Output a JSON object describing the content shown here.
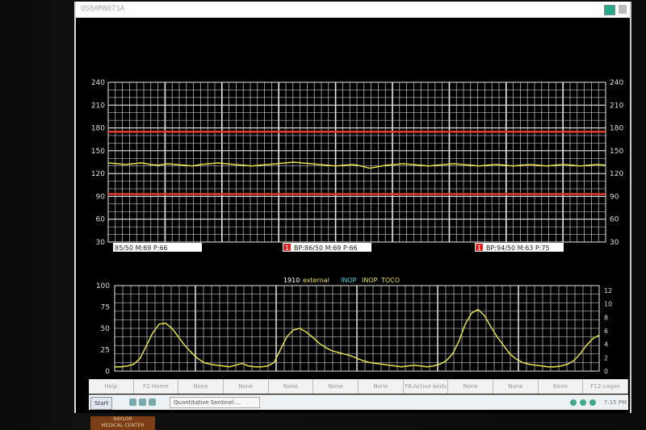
{
  "window": {
    "title": "QS0AM8071A"
  },
  "panel_top": {
    "y_ticks": [
      "240",
      "210",
      "180",
      "150",
      "120",
      "90",
      "60",
      "30"
    ],
    "status_boxes": [
      {
        "text": "85/50 M:69 P:66",
        "flag": ""
      },
      {
        "text": "BP:86/50 M:69 P:66",
        "flag": "1"
      },
      {
        "text": "BP:94/50 M:63 P:75",
        "flag": "1"
      }
    ],
    "colors": {
      "grid": "#e8e8e8",
      "trace": "#e6e04a",
      "limit": "#e23b2a",
      "box_bg": "#ffffff"
    },
    "limit_lines": [
      175,
      93
    ]
  },
  "panel_bottom": {
    "header": {
      "time": "1910",
      "source": "external",
      "status1": "INOP",
      "status2": "INOP",
      "label": "TOCO"
    },
    "y_ticks_left": [
      "100",
      "75",
      "50",
      "25",
      "0"
    ],
    "y_ticks_right": [
      "12",
      "10",
      "8",
      "6",
      "4",
      "2",
      "0"
    ],
    "colors": {
      "grid": "#e8e8e8",
      "trace": "#e6e04a"
    }
  },
  "chart_data": [
    {
      "type": "line",
      "title": "",
      "ylim": [
        30,
        240
      ],
      "y_ticks": [
        30,
        60,
        90,
        120,
        150,
        180,
        210,
        240
      ],
      "series": [
        {
          "values": [
            134,
            133,
            132,
            133,
            134,
            132,
            131,
            133,
            132,
            131,
            130,
            132,
            133,
            134,
            133,
            132,
            131,
            130,
            131,
            132,
            133,
            134,
            135,
            134,
            133,
            132,
            131,
            130,
            131,
            132,
            130,
            127,
            129,
            131,
            132,
            133,
            132,
            131,
            130,
            131,
            132,
            133,
            132,
            131,
            130,
            131,
            132,
            131,
            130,
            131,
            132,
            131,
            130,
            131,
            132,
            131,
            130,
            131,
            132,
            131
          ]
        }
      ],
      "limit_lines": [
        175,
        93
      ]
    },
    {
      "type": "line",
      "title": "",
      "ylim": [
        0,
        100
      ],
      "y_ticks": [
        0,
        25,
        50,
        75,
        100
      ],
      "series": [
        {
          "values": [
            5,
            5,
            6,
            8,
            15,
            30,
            45,
            55,
            56,
            50,
            40,
            30,
            22,
            15,
            10,
            8,
            7,
            6,
            5,
            7,
            9,
            6,
            5,
            5,
            6,
            10,
            25,
            40,
            48,
            50,
            46,
            40,
            33,
            28,
            24,
            22,
            20,
            18,
            15,
            12,
            10,
            9,
            8,
            7,
            6,
            5,
            6,
            7,
            6,
            5,
            6,
            8,
            12,
            20,
            35,
            55,
            68,
            72,
            65,
            52,
            40,
            30,
            20,
            14,
            10,
            8,
            7,
            6,
            5,
            5,
            6,
            8,
            12,
            20,
            30,
            38,
            42
          ]
        }
      ]
    }
  ],
  "fkeys": [
    "Help",
    "F2-Home",
    "None",
    "None",
    "None",
    "None",
    "None",
    "F8-Active beds",
    "None",
    "None",
    "None",
    "F12-Logon"
  ],
  "taskbar": {
    "start": "Start",
    "task": "Quantitative Sentinel ...",
    "clock": "7:15 PM"
  },
  "sticker": {
    "line1": "BAYLOR",
    "line2": "MEDICAL CENTER"
  }
}
